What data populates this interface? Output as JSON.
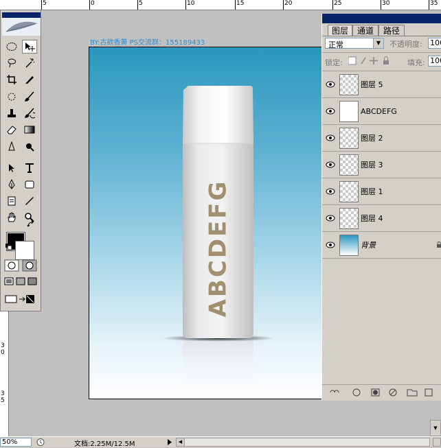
{
  "ruler": {
    "top_labels": [
      "5",
      "0",
      "5",
      "10",
      "15",
      "20",
      "25",
      "30",
      "35"
    ],
    "left_labels": [
      "3",
      "0",
      "3",
      "5"
    ]
  },
  "canvas": {
    "caption": "BY:古欲香萧 PS交流群：155189433",
    "bottle_text": "ABCDEFG",
    "background_top": "#2b97be",
    "background_bottom": "#ffffff",
    "text_color": "#a09070"
  },
  "tools": [
    "marquee-icon",
    "move-icon",
    "lasso-icon",
    "magic-wand-icon",
    "crop-icon",
    "slice-icon",
    "healing-icon",
    "brush-icon",
    "stamp-icon",
    "history-brush-icon",
    "eraser-icon",
    "gradient-icon",
    "blur-icon",
    "dodge-icon",
    "path-select-icon",
    "type-icon",
    "pen-icon",
    "shape-icon",
    "notes-icon",
    "eyedropper-icon",
    "hand-icon",
    "zoom-icon"
  ],
  "layers_panel": {
    "tabs": [
      "图层",
      "通道",
      "路径"
    ],
    "blend_mode": "正常",
    "opacity_label": "不透明度:",
    "opacity_value": "100",
    "lock_label": "锁定:",
    "fill_label": "填充:",
    "fill_value": "100",
    "layers": [
      {
        "name": "图层 5"
      },
      {
        "name": "ABCDEFG"
      },
      {
        "name": "图层 2"
      },
      {
        "name": "图层 3"
      },
      {
        "name": "图层 1"
      },
      {
        "name": "图层 4"
      },
      {
        "name": "背景"
      }
    ]
  },
  "status": {
    "zoom": "50%",
    "doc_info": "文档:2.25M/12.5M"
  },
  "colors": {
    "foreground": "#000000",
    "background": "#ffffff",
    "panel_bg": "#d4d0c8",
    "titlebar": "#0a246a"
  }
}
